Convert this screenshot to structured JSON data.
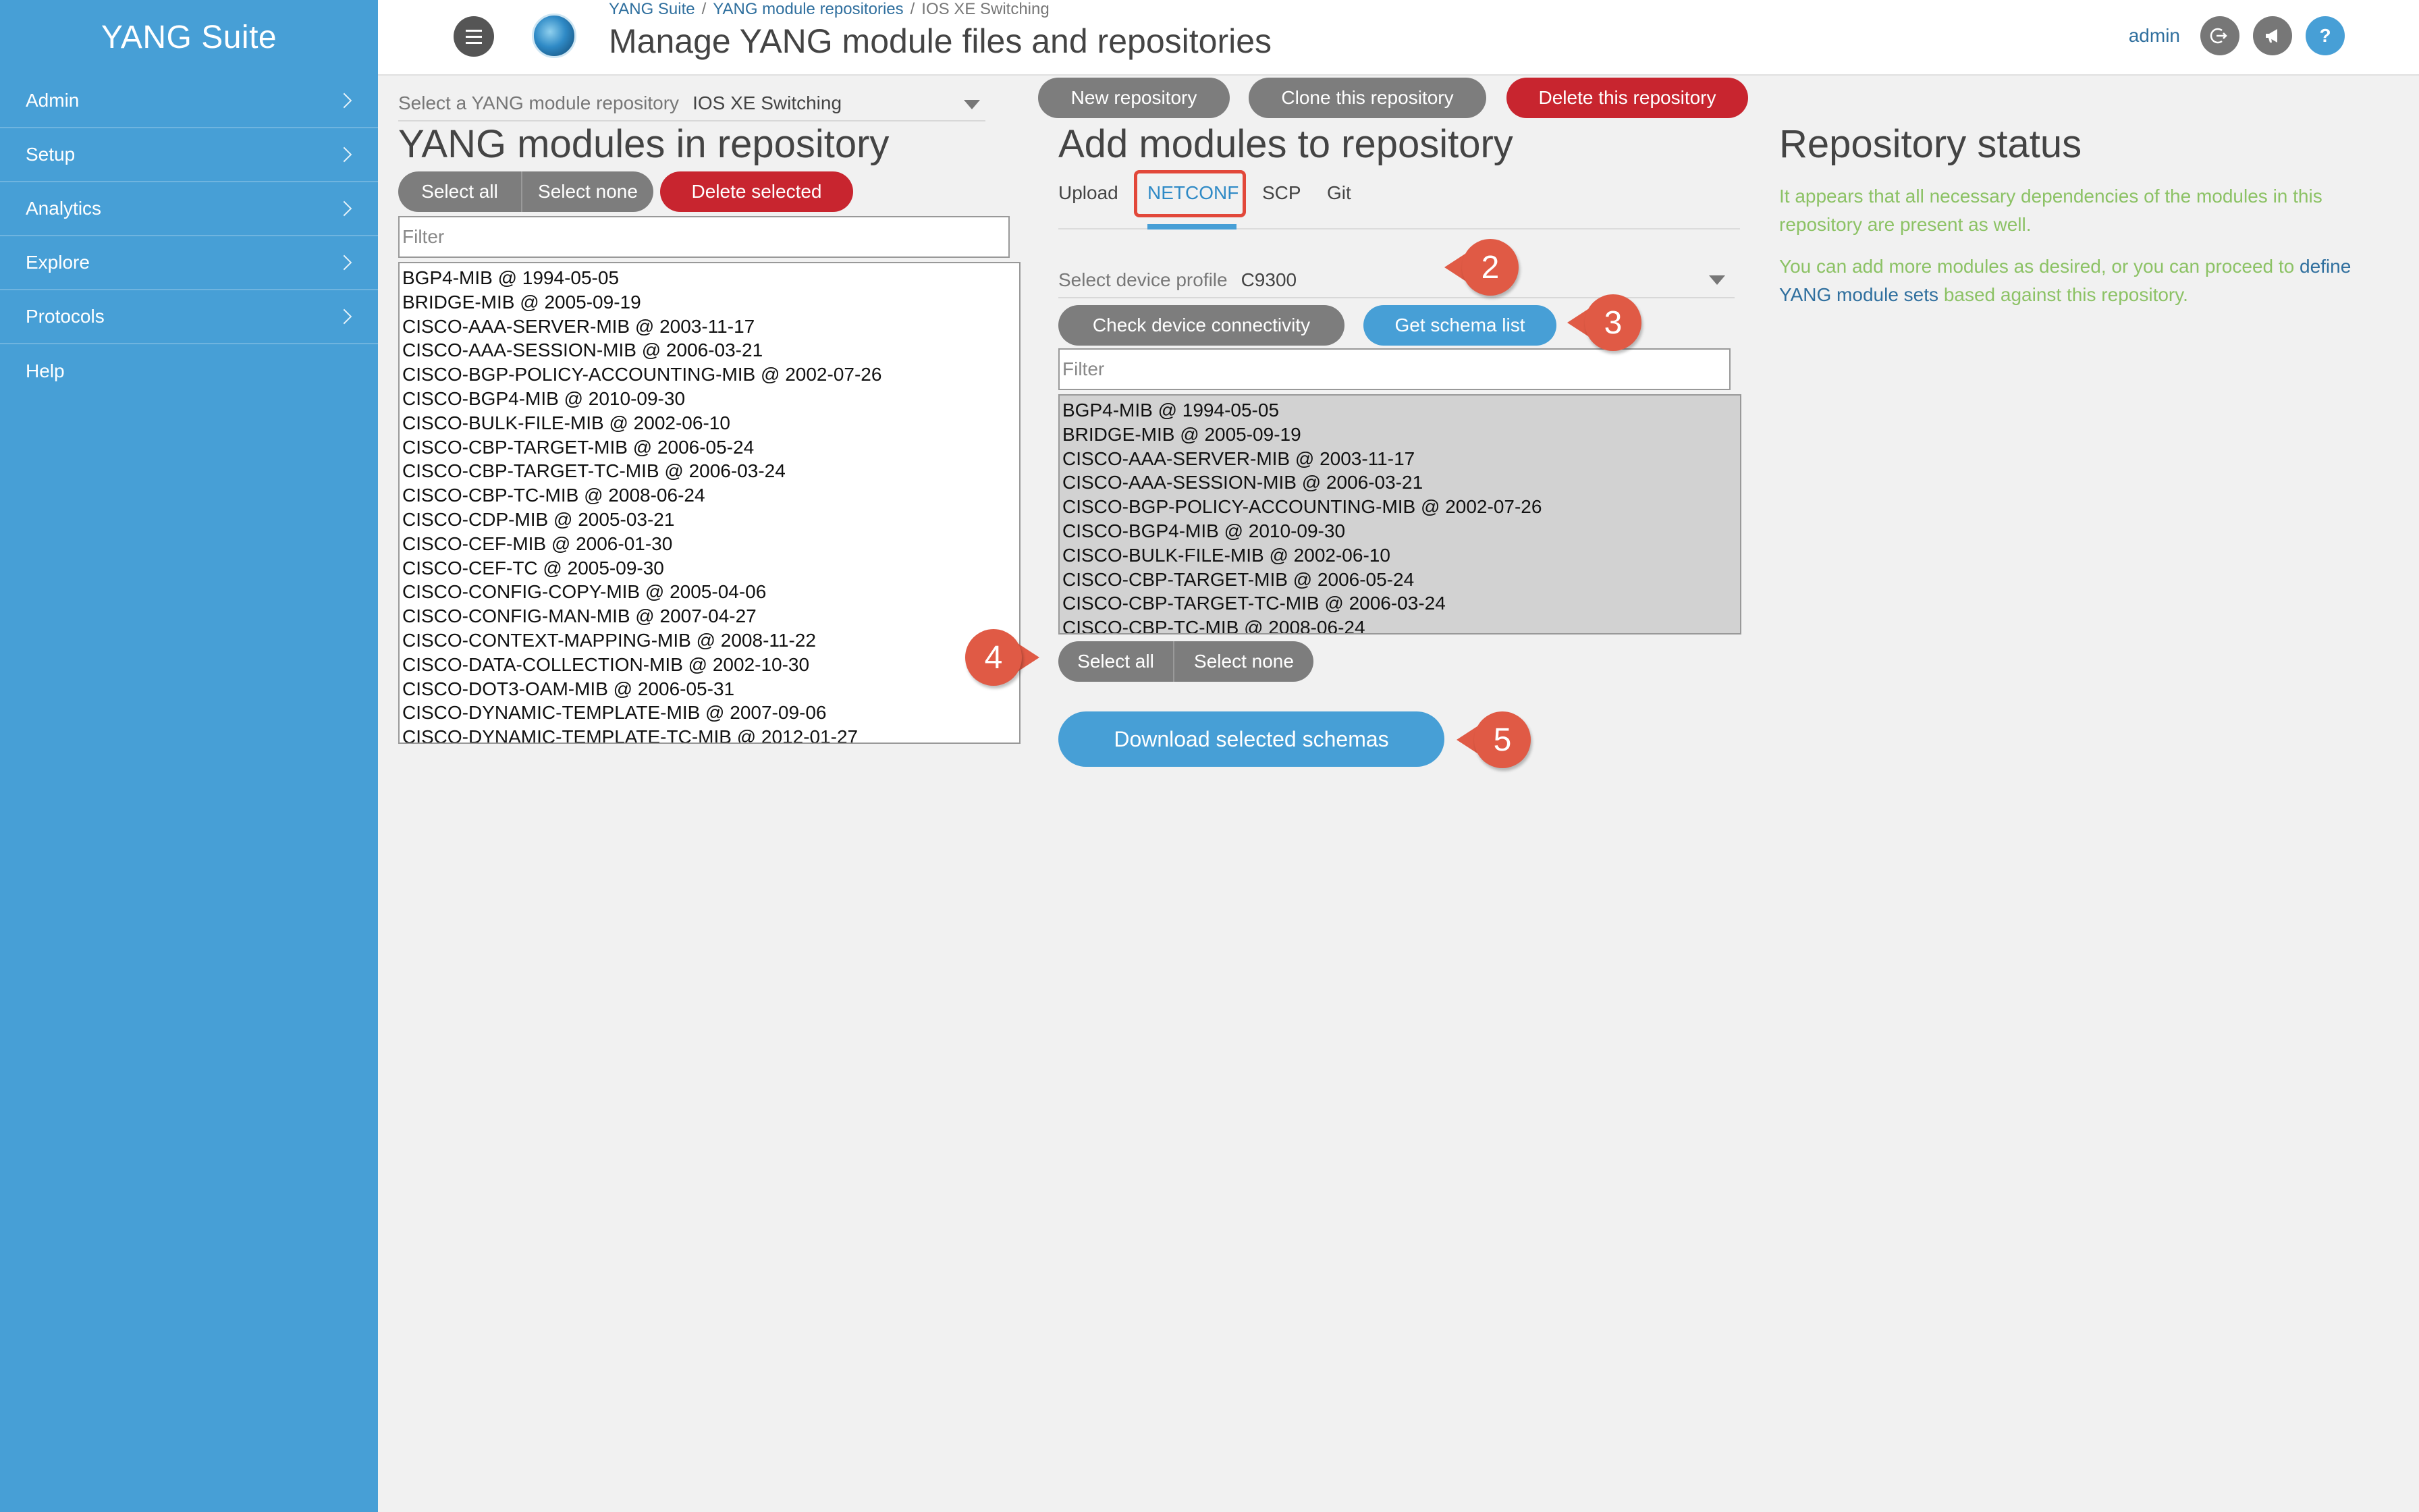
{
  "app": {
    "brand": "YANG Suite"
  },
  "sidebar": {
    "items": [
      {
        "label": "Admin"
      },
      {
        "label": "Setup"
      },
      {
        "label": "Analytics"
      },
      {
        "label": "Explore"
      },
      {
        "label": "Protocols"
      },
      {
        "label": "Help"
      }
    ]
  },
  "header": {
    "breadcrumb": [
      "YANG Suite",
      "YANG module repositories",
      "IOS XE Switching"
    ],
    "separator": "/",
    "title": "Manage YANG module files and repositories",
    "user": "admin",
    "icons": [
      "logout-icon",
      "megaphone-icon",
      "help-icon"
    ],
    "help_glyph": "?"
  },
  "repository_panel": {
    "select_label": "Select a YANG module repository",
    "select_value": "IOS XE Switching",
    "title": "YANG modules in repository",
    "select_all": "Select all",
    "select_none": "Select none",
    "delete_selected": "Delete selected",
    "filter_placeholder": "Filter",
    "modules": [
      "BGP4-MIB @ 1994-05-05",
      "BRIDGE-MIB @ 2005-09-19",
      "CISCO-AAA-SERVER-MIB @ 2003-11-17",
      "CISCO-AAA-SESSION-MIB @ 2006-03-21",
      "CISCO-BGP-POLICY-ACCOUNTING-MIB @ 2002-07-26",
      "CISCO-BGP4-MIB @ 2010-09-30",
      "CISCO-BULK-FILE-MIB @ 2002-06-10",
      "CISCO-CBP-TARGET-MIB @ 2006-05-24",
      "CISCO-CBP-TARGET-TC-MIB @ 2006-03-24",
      "CISCO-CBP-TC-MIB @ 2008-06-24",
      "CISCO-CDP-MIB @ 2005-03-21",
      "CISCO-CEF-MIB @ 2006-01-30",
      "CISCO-CEF-TC @ 2005-09-30",
      "CISCO-CONFIG-COPY-MIB @ 2005-04-06",
      "CISCO-CONFIG-MAN-MIB @ 2007-04-27",
      "CISCO-CONTEXT-MAPPING-MIB @ 2008-11-22",
      "CISCO-DATA-COLLECTION-MIB @ 2002-10-30",
      "CISCO-DOT3-OAM-MIB @ 2006-05-31",
      "CISCO-DYNAMIC-TEMPLATE-MIB @ 2007-09-06",
      "CISCO-DYNAMIC-TEMPLATE-TC-MIB @ 2012-01-27"
    ]
  },
  "repo_actions": {
    "new": "New repository",
    "clone": "Clone this repository",
    "delete": "Delete this repository"
  },
  "add_panel": {
    "title": "Add modules to repository",
    "tabs": [
      "Upload",
      "NETCONF",
      "SCP",
      "Git"
    ],
    "active_tab": "NETCONF",
    "device_label": "Select device profile",
    "device_value": "C9300",
    "check_connectivity": "Check device connectivity",
    "get_schema_list": "Get schema list",
    "filter_placeholder": "Filter",
    "schemas": [
      "BGP4-MIB @ 1994-05-05",
      "BRIDGE-MIB @ 2005-09-19",
      "CISCO-AAA-SERVER-MIB @ 2003-11-17",
      "CISCO-AAA-SESSION-MIB @ 2006-03-21",
      "CISCO-BGP-POLICY-ACCOUNTING-MIB @ 2002-07-26",
      "CISCO-BGP4-MIB @ 2010-09-30",
      "CISCO-BULK-FILE-MIB @ 2002-06-10",
      "CISCO-CBP-TARGET-MIB @ 2006-05-24",
      "CISCO-CBP-TARGET-TC-MIB @ 2006-03-24",
      "CISCO-CBP-TC-MIB @ 2008-06-24"
    ],
    "select_all": "Select all",
    "select_none": "Select none",
    "download": "Download selected schemas"
  },
  "callouts": {
    "c2": "2",
    "c3": "3",
    "c4": "4",
    "c5": "5"
  },
  "status_panel": {
    "title": "Repository status",
    "line1": "It appears that all necessary dependencies of the modules in this repository are present as well.",
    "line2_pre": "You can add more modules as desired, or you can proceed to",
    "line2_link": "define YANG module sets",
    "line2_post": "based against this repository."
  },
  "colors": {
    "sidebar": "#479fd6",
    "danger": "#c8252f",
    "primary": "#479fd6",
    "neutral": "#7d7d7d",
    "callout": "#e05a45",
    "status_text": "#8cc265"
  }
}
